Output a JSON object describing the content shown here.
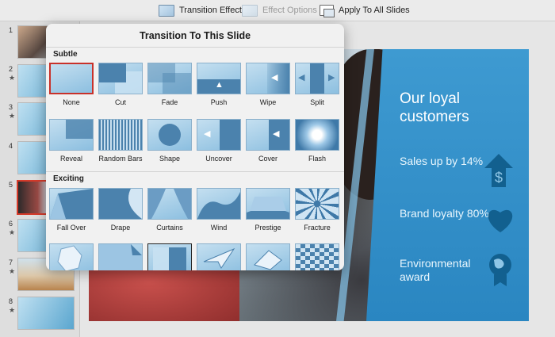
{
  "toolbar": {
    "transition_effect": "Transition Effect",
    "effect_options": "Effect Options",
    "apply_all": "Apply To All Slides"
  },
  "slide_numbers": [
    "1",
    "2",
    "3",
    "4",
    "5",
    "6",
    "7",
    "8"
  ],
  "star": "★",
  "popover": {
    "title": "Transition To This Slide",
    "subtle_label": "Subtle",
    "exciting_label": "Exciting",
    "subtle": [
      "None",
      "Cut",
      "Fade",
      "Push",
      "Wipe",
      "Split",
      "Reveal",
      "Random Bars",
      "Shape",
      "Uncover",
      "Cover",
      "Flash"
    ],
    "exciting": [
      "Fall Over",
      "Drape",
      "Curtains",
      "Wind",
      "Prestige",
      "Fracture"
    ],
    "selected": "None"
  },
  "slide": {
    "heading": "Our loyal customers",
    "row1": "Sales up by 14%",
    "row2": "Brand loyalty 80%",
    "row3": "Environmental award",
    "icons": [
      "dollar-arrow-icon",
      "heart-icon",
      "globe-award-icon"
    ]
  },
  "colors": {
    "selection": "#c8312a",
    "panel_blue": "#2a86c1",
    "tile_blue": "#4b82ad"
  }
}
